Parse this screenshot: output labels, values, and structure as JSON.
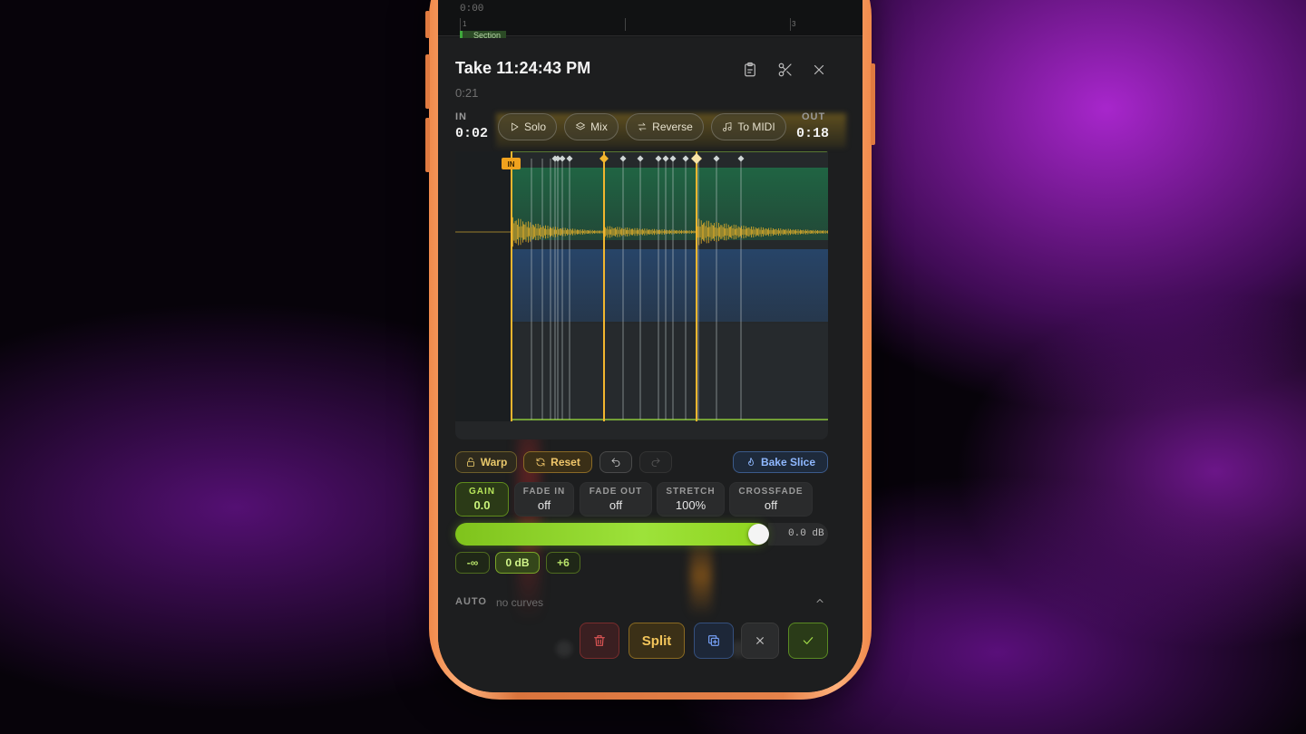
{
  "timeline": {
    "time": "0:00",
    "tick1": "1",
    "tick3": "3",
    "section_label": "Section"
  },
  "header": {
    "title": "Take 11:24:43 PM",
    "duration": "0:21"
  },
  "icons": {
    "clipboard": "clipboard-icon",
    "scissors": "scissors-icon",
    "close": "close-icon"
  },
  "range": {
    "in_label": "IN",
    "in_value": "0:02",
    "out_label": "OUT",
    "out_value": "0:18",
    "in_marker": "IN"
  },
  "toolbar": {
    "solo": "Solo",
    "mix": "Mix",
    "reverse": "Reverse",
    "to_midi": "To MIDI"
  },
  "controls": {
    "warp": "Warp",
    "reset": "Reset",
    "bake": "Bake Slice"
  },
  "params": [
    {
      "label": "GAIN",
      "value": "0.0"
    },
    {
      "label": "FADE IN",
      "value": "off"
    },
    {
      "label": "FADE OUT",
      "value": "off"
    },
    {
      "label": "STRETCH",
      "value": "100%"
    },
    {
      "label": "CROSSFADE",
      "value": "off"
    }
  ],
  "gain_slider": {
    "value_label": "0.0 dB",
    "level": 0.84
  },
  "presets": {
    "minus_inf": "-∞",
    "zero": "0 dB",
    "plus6": "+6"
  },
  "automation": {
    "label": "AUTO",
    "value": "no curves"
  },
  "actions": {
    "split": "Split"
  },
  "colors": {
    "accent_gain": "#9de23a",
    "accent_warp": "#f0b429",
    "accent_bake": "#8fb8ff",
    "danger": "#e05656"
  }
}
